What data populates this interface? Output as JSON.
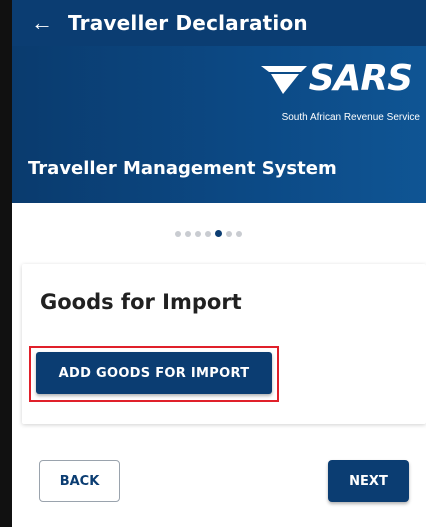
{
  "appbar": {
    "title": "Traveller Declaration",
    "back_icon": "arrow-left-icon"
  },
  "banner": {
    "logo_text": "SARS",
    "logo_subtitle": "South African Revenue Service",
    "system_title": "Traveller Management System"
  },
  "stepper": {
    "total_steps": 7,
    "current_step": 5
  },
  "card": {
    "title": "Goods for Import",
    "add_button": "ADD GOODS FOR IMPORT"
  },
  "footer": {
    "back_label": "BACK",
    "next_label": "NEXT"
  },
  "colors": {
    "primary": "#0b3d72",
    "highlight": "#e0202a",
    "dot_inactive": "#c9ccd1"
  }
}
